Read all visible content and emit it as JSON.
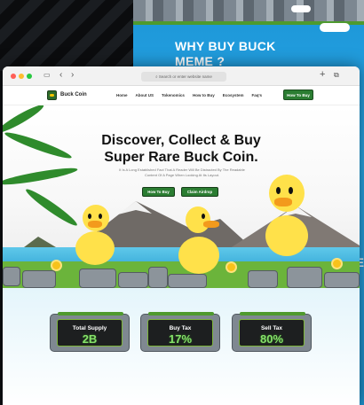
{
  "back_slide": {
    "heading": "WHY BUY BUCK MEME ?",
    "partial_letter": "E"
  },
  "browser": {
    "address": "Search or enter website name"
  },
  "nav": {
    "brand": "Buck Coin",
    "links": [
      "Home",
      "About US",
      "Tokenomics",
      "How to Buy",
      "Ecosystem",
      "Faq's"
    ],
    "cta": "How To Buy"
  },
  "hero": {
    "title_line1": "Discover, Collect & Buy",
    "title_line2": "Super Rare Buck Coin.",
    "subtitle": "It Is A Long Established Fact That A Reader Will Be Distracted By The Readable Content Of A Page When Looking At Its Layout.",
    "btn_primary": "How To Buy",
    "btn_secondary": "Claim Airdrop"
  },
  "stats": [
    {
      "label": "Total Supply",
      "value": "2B"
    },
    {
      "label": "Buy Tax",
      "value": "17%"
    },
    {
      "label": "Sell Tax",
      "value": "80%"
    }
  ],
  "colors": {
    "accent_green": "#2b7d32",
    "stat_value": "#86e26a",
    "back_blue": "#1c96d8"
  }
}
